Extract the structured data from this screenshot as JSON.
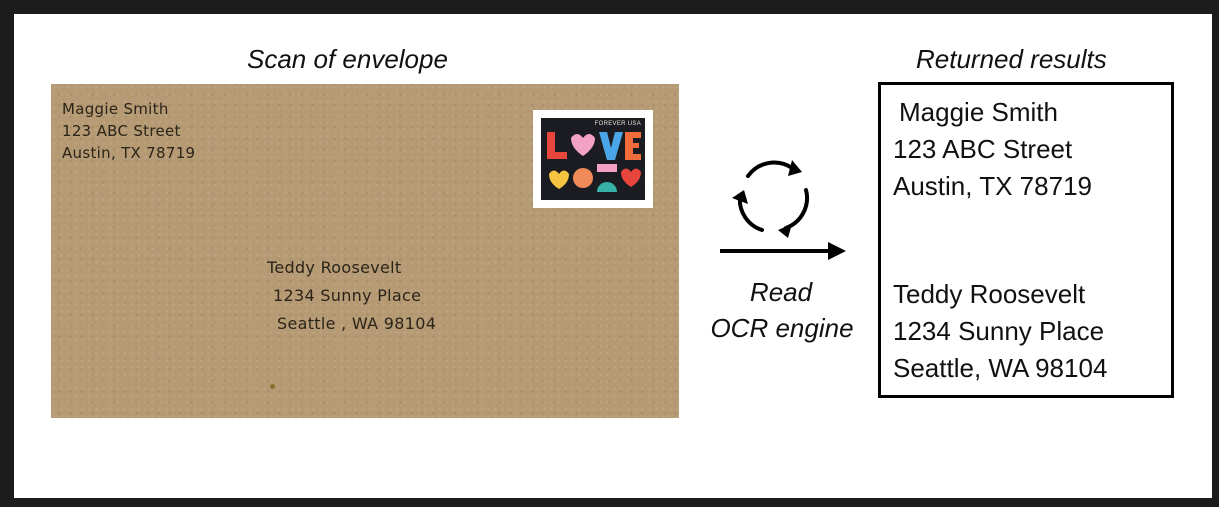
{
  "captions": {
    "scan": "Scan of envelope",
    "results": "Returned results"
  },
  "envelope": {
    "return_address": [
      "Maggie Smith",
      "123 ABC Street",
      "Austin, TX 78719"
    ],
    "recipient": [
      "Teddy Roosevelt",
      "1234 Sunny Place",
      "Seattle , WA 98104"
    ],
    "stamp": {
      "text": "FOREVER USA",
      "word": [
        "L",
        "O",
        "V",
        "E"
      ]
    }
  },
  "process": {
    "icon": "refresh-cycle-icon",
    "arrow_icon": "arrow-right-icon",
    "label_line1": "Read",
    "label_line2": "OCR engine"
  },
  "results": {
    "sender": [
      "Maggie Smith",
      "123 ABC Street",
      "Austin, TX 78719"
    ],
    "recipient": [
      "Teddy Roosevelt",
      "1234 Sunny Place",
      "Seattle, WA 98104"
    ]
  },
  "colors": {
    "envelope": "#b59a74",
    "ink": "#2b2418",
    "stamp_bg": "#1b1b22"
  }
}
